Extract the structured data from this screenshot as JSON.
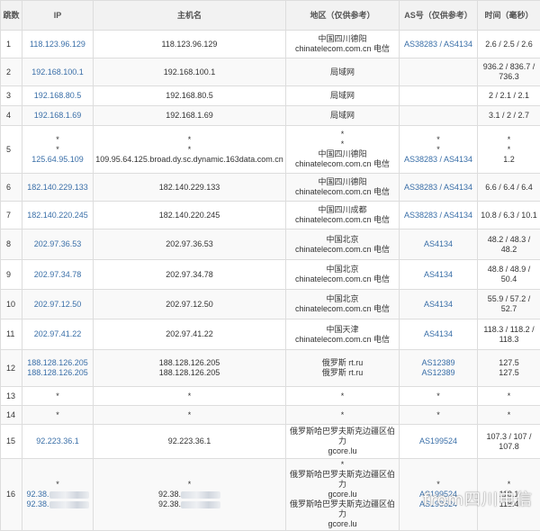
{
  "headers": {
    "hop": "跳数",
    "ip": "IP",
    "host": "主机名",
    "geo": "地区（仅供参考）",
    "as": "AS号（仅供参考）",
    "time": "时间（毫秒）"
  },
  "rows": [
    {
      "hop": "1",
      "ip": [
        "118.123.96.129"
      ],
      "host": [
        "118.123.96.129"
      ],
      "geo": [
        "中国四川德阳",
        "chinatelecom.com.cn 电信"
      ],
      "as": [
        "AS38283 / AS4134"
      ],
      "time": [
        "2.6 / 2.5 / 2.6"
      ],
      "height": 31
    },
    {
      "hop": "2",
      "ip": [
        "192.168.100.1"
      ],
      "host": [
        "192.168.100.1"
      ],
      "geo": [
        "局域网"
      ],
      "as": [],
      "time": [
        "936.2 / 836.7 / 736.3"
      ],
      "height": 31
    },
    {
      "hop": "3",
      "ip": [
        "192.168.80.5"
      ],
      "host": [
        "192.168.80.5"
      ],
      "geo": [
        "局域网"
      ],
      "as": [],
      "time": [
        "2 / 2.1 / 2.1"
      ],
      "height": 22
    },
    {
      "hop": "4",
      "ip": [
        "192.168.1.69"
      ],
      "host": [
        "192.168.1.69"
      ],
      "geo": [
        "局域网"
      ],
      "as": [],
      "time": [
        "3.1 / 2 / 2.7"
      ],
      "height": 22
    },
    {
      "hop": "5",
      "ip": [
        "*",
        "*",
        "125.64.95.109"
      ],
      "host": [
        "*",
        "*",
        "109.95.64.125.broad.dy.sc.dynamic.163data.com.cn"
      ],
      "geo": [
        "*",
        "*",
        "中国四川德阳",
        "chinatelecom.com.cn 电信"
      ],
      "as": [
        "*",
        "*",
        "AS38283 / AS4134"
      ],
      "time": [
        "*",
        "*",
        "1.2"
      ],
      "height": 53
    },
    {
      "hop": "6",
      "ip": [
        "182.140.229.133"
      ],
      "host": [
        "182.140.229.133"
      ],
      "geo": [
        "中国四川德阳",
        "chinatelecom.com.cn 电信"
      ],
      "as": [
        "AS38283 / AS4134"
      ],
      "time": [
        "6.6 / 6.4 / 6.4"
      ],
      "height": 31
    },
    {
      "hop": "7",
      "ip": [
        "182.140.220.245"
      ],
      "host": [
        "182.140.220.245"
      ],
      "geo": [
        "中国四川成都",
        "chinatelecom.com.cn 电信"
      ],
      "as": [
        "AS38283 / AS4134"
      ],
      "time": [
        "10.8 / 6.3 / 10.1"
      ],
      "height": 31
    },
    {
      "hop": "8",
      "ip": [
        "202.97.36.53"
      ],
      "host": [
        "202.97.36.53"
      ],
      "geo": [
        "中国北京 chinatelecom.com.cn 电信"
      ],
      "as": [
        "AS4134"
      ],
      "time": [
        "48.2 / 48.3 / 48.2"
      ],
      "height": 34
    },
    {
      "hop": "9",
      "ip": [
        "202.97.34.78"
      ],
      "host": [
        "202.97.34.78"
      ],
      "geo": [
        "中国北京 chinatelecom.com.cn 电信"
      ],
      "as": [
        "AS4134"
      ],
      "time": [
        "48.8 / 48.9 / 50.4"
      ],
      "height": 33
    },
    {
      "hop": "10",
      "ip": [
        "202.97.12.50"
      ],
      "host": [
        "202.97.12.50"
      ],
      "geo": [
        "中国北京 chinatelecom.com.cn 电信"
      ],
      "as": [
        "AS4134"
      ],
      "time": [
        "55.9 / 57.2 / 52.7"
      ],
      "height": 33
    },
    {
      "hop": "11",
      "ip": [
        "202.97.41.22"
      ],
      "host": [
        "202.97.41.22"
      ],
      "geo": [
        "中国天津 chinatelecom.com.cn 电信"
      ],
      "as": [
        "AS4134"
      ],
      "time": [
        "118.3 / 118.2 / 118.3"
      ],
      "height": 34
    },
    {
      "hop": "12",
      "ip": [
        "188.128.126.205",
        "188.128.126.205"
      ],
      "host": [
        "188.128.126.205",
        "188.128.126.205"
      ],
      "geo": [
        "俄罗斯 rt.ru",
        "俄罗斯 rt.ru"
      ],
      "as": [
        "AS12389",
        "AS12389"
      ],
      "time": [
        "127.5",
        "127.5"
      ],
      "height": 41
    },
    {
      "hop": "13",
      "ip": [
        "*"
      ],
      "host": [
        "*"
      ],
      "geo": [
        "*"
      ],
      "as": [
        "*"
      ],
      "time": [
        "*"
      ],
      "height": 21
    },
    {
      "hop": "14",
      "ip": [
        "*"
      ],
      "host": [
        "*"
      ],
      "geo": [
        "*"
      ],
      "as": [
        "*"
      ],
      "time": [
        "*"
      ],
      "height": 21
    },
    {
      "hop": "15",
      "ip": [
        "92.223.36.1"
      ],
      "host": [
        "92.223.36.1"
      ],
      "geo": [
        "俄罗斯哈巴罗夫斯克边疆区伯力",
        "gcore.lu"
      ],
      "as": [
        "AS199524"
      ],
      "time": [
        "107.3 / 107 / 107.8"
      ],
      "height": 38
    },
    {
      "hop": "16",
      "ip": [
        "*",
        "92.38.",
        "92.38."
      ],
      "host": [
        "*",
        "92.38.",
        "92.38."
      ],
      "geo": [
        "*",
        "俄罗斯哈巴罗夫斯克边疆区伯力",
        "gcore.lu",
        "俄罗斯哈巴罗夫斯克边疆区伯力",
        "gcore.lu"
      ],
      "as": [
        "*",
        "AS199524",
        "AS199524"
      ],
      "time": [
        "*",
        "118.1",
        "118.4"
      ],
      "height": 58,
      "masked": true
    }
  ],
  "watermark": "from四川电信"
}
